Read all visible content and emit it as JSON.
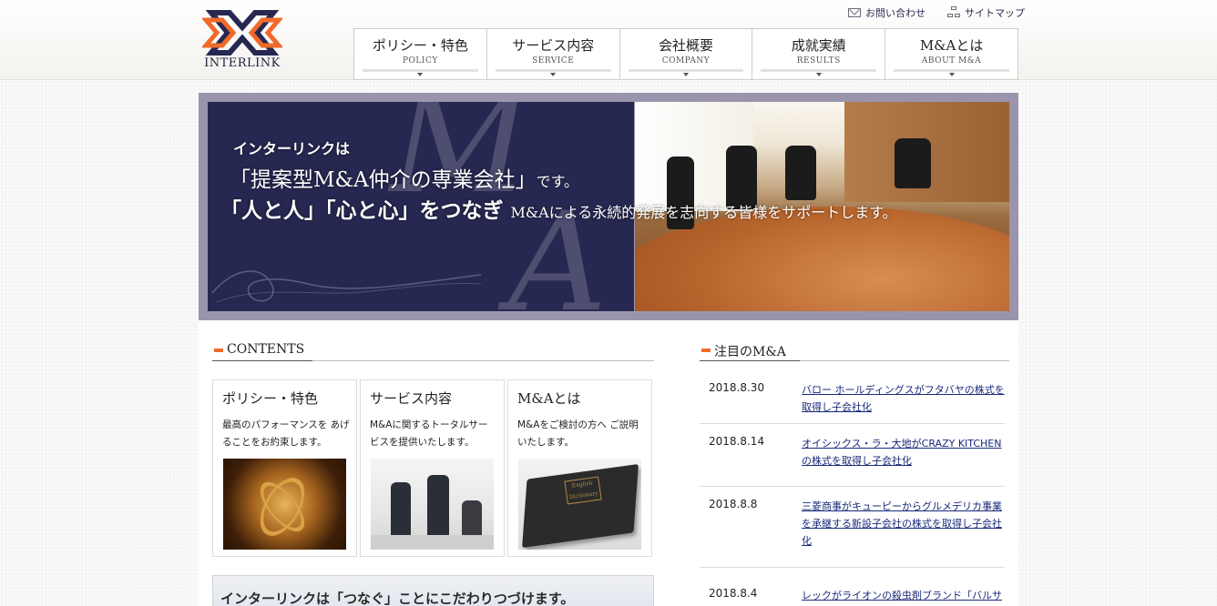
{
  "header": {
    "logo_text": "INTERLINK",
    "contact_label": "お問い合わせ",
    "sitemap_label": "サイトマップ",
    "nav": [
      {
        "jp": "ポリシー・特色",
        "en": "POLICY"
      },
      {
        "jp": "サービス内容",
        "en": "SERVICE"
      },
      {
        "jp": "会社概要",
        "en": "COMPANY"
      },
      {
        "jp": "成就実績",
        "en": "RESULTS"
      },
      {
        "jp": "M&Aとは",
        "en": "ABOUT M&A"
      }
    ]
  },
  "hero": {
    "line1": "インターリンクは",
    "line2_main": "「提案型M&A仲介の専業会社」",
    "line2_tail": "です。",
    "line3_main": "「人と人」「心と心」をつなぎ",
    "line3_tail": "M&Aによる永続的発展を志向する皆様をサポートします。",
    "watermark_m": "M",
    "watermark_a": "A"
  },
  "contents": {
    "heading": "CONTENTS",
    "cards": [
      {
        "title": "ポリシー・特色",
        "desc": "最高のパフォーマンスを あげることをお約束します。"
      },
      {
        "title": "サービス内容",
        "desc": "M&Aに関するトータルサー ビスを提供いたします。"
      },
      {
        "title": "M&Aとは",
        "desc": "M&Aをご検討の方へ ご説明いたします。"
      }
    ],
    "book_label": "English Dictionary",
    "tagline": "インターリンクは「つなぐ」ことにこだわりつづけます。"
  },
  "news": {
    "heading": "注目のM&A",
    "items": [
      {
        "date": "2018.8.30",
        "title": "バロー ホールディングスがフタバヤの株式を取得し子会社化"
      },
      {
        "date": "2018.8.14",
        "title": "オイシックス・ラ・大地がCRAZY KITCHENの株式を取得し子会社化"
      },
      {
        "date": "2018.8.8",
        "title": "三菱商事がキューピーからグルメデリカ事業を承継する新設子会社の株式を取得し子会社化"
      },
      {
        "date": "2018.8.4",
        "title": "レックがライオンの殺虫剤ブランド「バルサン」"
      }
    ]
  },
  "colors": {
    "accent": "#f06a2a",
    "navy": "#262851",
    "link": "#1a2a7a"
  }
}
